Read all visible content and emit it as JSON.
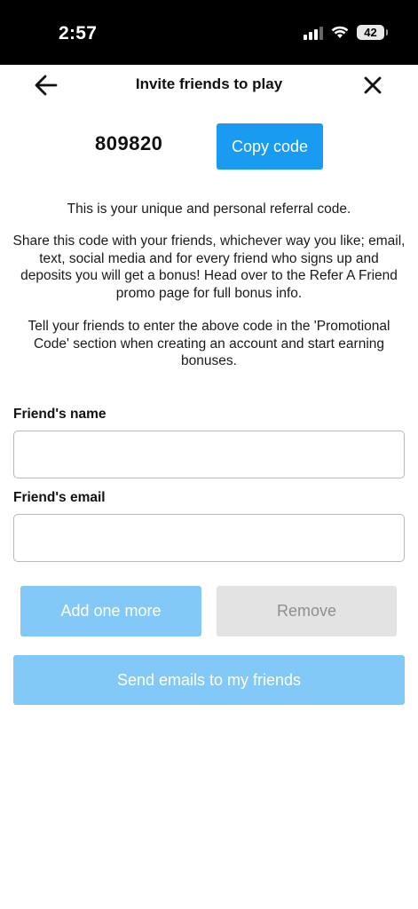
{
  "status_bar": {
    "time": "2:57",
    "battery": "42"
  },
  "header": {
    "title": "Invite friends to play",
    "back_icon": "arrow-left-icon",
    "close_icon": "close-icon"
  },
  "referral": {
    "code": "809820",
    "copy_label": "Copy code"
  },
  "info": {
    "line1": "This is your unique and personal referral code.",
    "line2": "Share this code with your friends, whichever way you like; email, text, social media and for every friend who signs up and deposits you will get a bonus! Head over to the Refer A Friend promo page for full bonus info.",
    "line3": "Tell your friends to enter the above code in the 'Promotional Code' section when creating an account and start earning bonuses."
  },
  "form": {
    "name_label": "Friend's name",
    "name_value": "",
    "email_label": "Friend's email",
    "email_value": "",
    "add_label": "Add one more",
    "remove_label": "Remove",
    "send_label": "Send emails to my friends"
  },
  "colors": {
    "primary": "#1a9bf2",
    "primary_disabled": "#82c9f7",
    "neutral_disabled": "#e3e3e3"
  }
}
